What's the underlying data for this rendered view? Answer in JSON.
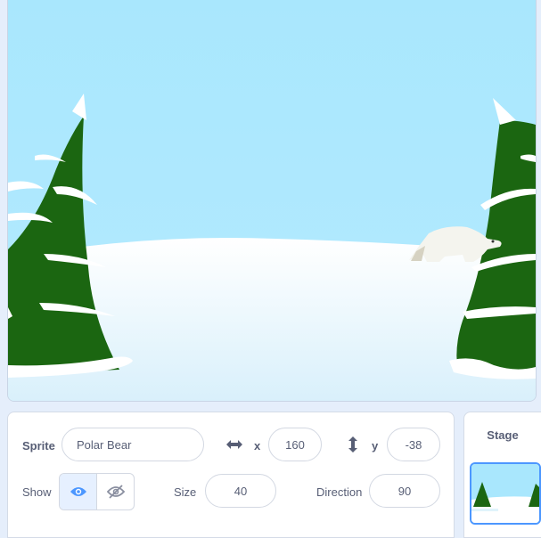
{
  "sprite_info": {
    "sprite_label": "Sprite",
    "sprite_name": "Polar Bear",
    "x_label": "x",
    "x_value": "160",
    "y_label": "y",
    "y_value": "-38",
    "show_label": "Show",
    "show_visible": true,
    "size_label": "Size",
    "size_value": "40",
    "direction_label": "Direction",
    "direction_value": "90"
  },
  "stage_panel": {
    "title": "Stage"
  },
  "icons": {
    "x_arrow": "horizontal-arrows-icon",
    "y_arrow": "vertical-arrows-icon",
    "show": "eye-icon",
    "hide": "eye-slash-icon"
  },
  "colors": {
    "sky": "#a9e5fb",
    "snow": "#ffffff",
    "tree": "#1b6611",
    "accent": "#4c97ff",
    "text": "#575e75"
  }
}
